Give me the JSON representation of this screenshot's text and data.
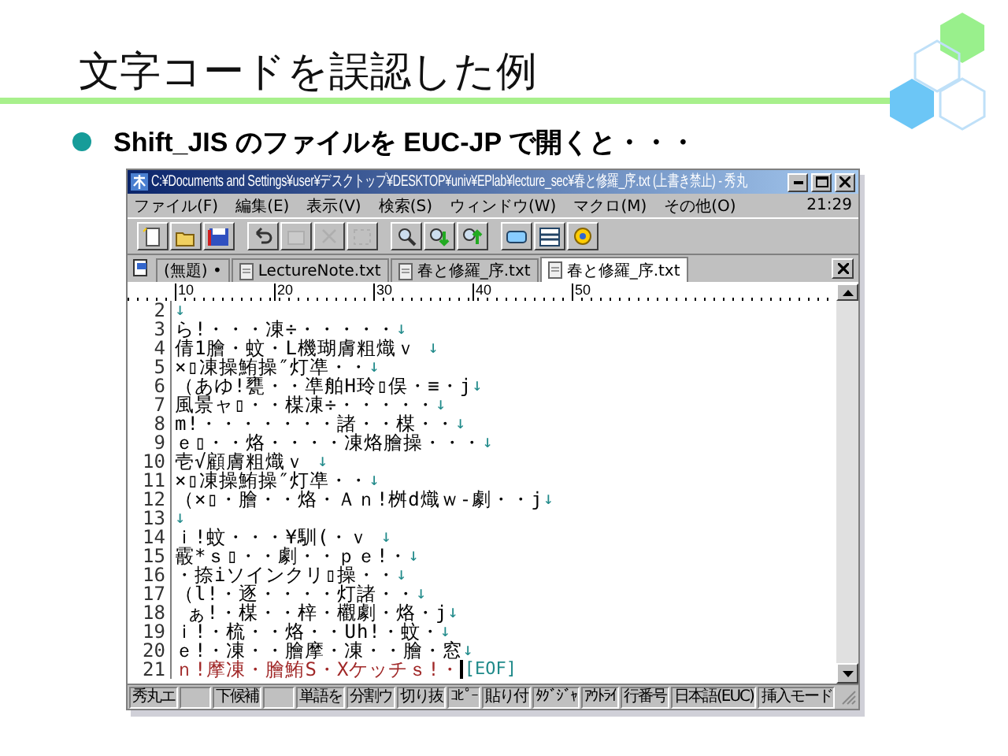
{
  "slide": {
    "title": "文字コードを誤認した例",
    "bullet": "Shift_JIS  のファイルを EUC-JP で開くと・・・"
  },
  "window": {
    "title": "C:¥Documents and Settings¥user¥デスクトップ¥DESKTOP¥univ¥EPlab¥lecture_sec¥春と修羅_序.txt (上書き禁止) - 秀丸",
    "menu": [
      "ファイル(F)",
      "編集(E)",
      "表示(V)",
      "検索(S)",
      "ウィンドウ(W)",
      "マクロ(M)",
      "その他(O)"
    ],
    "clock": "21:29",
    "toolbar": [
      {
        "buttons": [
          {
            "kind": "new",
            "disabled": false
          },
          {
            "kind": "open",
            "disabled": false
          },
          {
            "kind": "save",
            "disabled": false
          }
        ]
      },
      {
        "buttons": [
          {
            "kind": "undo",
            "disabled": false
          },
          {
            "kind": "paste",
            "disabled": true
          },
          {
            "kind": "cut",
            "disabled": true
          },
          {
            "kind": "select",
            "disabled": true
          }
        ]
      },
      {
        "buttons": [
          {
            "kind": "search",
            "disabled": false
          },
          {
            "kind": "search-down",
            "disabled": false
          },
          {
            "kind": "search-up",
            "disabled": false
          }
        ]
      },
      {
        "buttons": [
          {
            "kind": "window",
            "disabled": false
          },
          {
            "kind": "list",
            "disabled": false
          },
          {
            "kind": "help",
            "disabled": false
          }
        ]
      }
    ],
    "tabs": [
      {
        "label": "(無題) •",
        "selected": false
      },
      {
        "label": "LectureNote.txt",
        "selected": false
      },
      {
        "label": "春と修羅_序.txt",
        "selected": false
      },
      {
        "label": "春と修羅_序.txt",
        "selected": true
      }
    ],
    "ruler": [
      "10",
      "20",
      "30",
      "40",
      "50"
    ],
    "lines": [
      {
        "number": "2",
        "end": "↓",
        "kind": "text"
      },
      {
        "number": "3",
        "text": "ら!・・・凍÷・・・・・",
        "end": "↓",
        "kind": "text"
      },
      {
        "number": "4",
        "text": "倩1膾・蚊・L機瑚膚粗熾ｖ ",
        "end": "↓",
        "kind": "text"
      },
      {
        "number": "5",
        "text": "×▯凍操鮪操″灯凖・・",
        "end": "↓",
        "kind": "text"
      },
      {
        "number": "6",
        "text": "（あゆ!甕・・凖舶H玲▯俣・≡・j",
        "end": "↓",
        "kind": "text"
      },
      {
        "number": "7",
        "text": "風景ャ▯・・楳凍÷・・・・・",
        "end": "↓",
        "kind": "text"
      },
      {
        "number": "8",
        "text": "m!・・・・・・・諸・・楳・・",
        "end": "↓",
        "kind": "text"
      },
      {
        "number": "9",
        "text": "ｅ▯・・烙・・・・凍烙膾操・・・",
        "end": "↓",
        "kind": "text"
      },
      {
        "number": "10",
        "text": "壱√顧膚粗熾ｖ ",
        "end": "↓",
        "kind": "text"
      },
      {
        "number": "11",
        "text": "×▯凍操鮪操″灯凖・・",
        "end": "↓",
        "kind": "text"
      },
      {
        "number": "12",
        "text": "（×▯・膾・・烙・Ａｎ!桝d熾ｗ-劇・・j",
        "end": "↓",
        "kind": "text"
      },
      {
        "number": "13",
        "end": "↓",
        "kind": "text"
      },
      {
        "number": "14",
        "text": "ｉ!蚊・・・¥馴(・ｖ ",
        "end": "↓",
        "kind": "text"
      },
      {
        "number": "15",
        "text": "霰*ｓ▯・・劇・・ｐｅ!・",
        "end": "↓",
        "kind": "text"
      },
      {
        "number": "16",
        "text": "・捺iソインクリ▯操・・",
        "end": "↓",
        "kind": "text"
      },
      {
        "number": "17",
        "text": "（l!・逐・・・・灯諸・・",
        "end": "↓",
        "kind": "text"
      },
      {
        "number": "18",
        "text": " ぁ!・楳・・梓・欟劇・烙・j",
        "end": "↓",
        "kind": "text"
      },
      {
        "number": "19",
        "text": "ｉ!・梳・・烙・・Uh!・蚊・",
        "end": "↓",
        "kind": "text"
      },
      {
        "number": "20",
        "text": "ｅ!・凍・・膾摩・凍・・膾・窓",
        "end": "↓",
        "kind": "text"
      },
      {
        "number": "21",
        "text": "ｎ!摩凍・膾鮪S・Xケッチｓ!・",
        "end": "[EOF]",
        "kind": "eof"
      }
    ],
    "status": [
      {
        "kind": "text",
        "label": "秀丸エ"
      },
      {
        "kind": "blank"
      },
      {
        "kind": "text",
        "label": "下候補"
      },
      {
        "kind": "blank"
      },
      {
        "kind": "text",
        "label": "単語を"
      },
      {
        "kind": "text",
        "label": "分割ウ"
      },
      {
        "kind": "text",
        "label": "切り抜"
      },
      {
        "kind": "text",
        "label": "ｺﾋﾟｰ"
      },
      {
        "kind": "text",
        "label": "貼り付"
      },
      {
        "kind": "text",
        "label": "ﾀｸﾞｼﾞｬ"
      },
      {
        "kind": "text",
        "label": "ｱｳﾄﾗｲ"
      },
      {
        "kind": "text",
        "label": "行番号"
      },
      {
        "kind": "text",
        "label": "日本語(EUC)"
      },
      {
        "kind": "text",
        "label": "挿入モード"
      }
    ]
  }
}
